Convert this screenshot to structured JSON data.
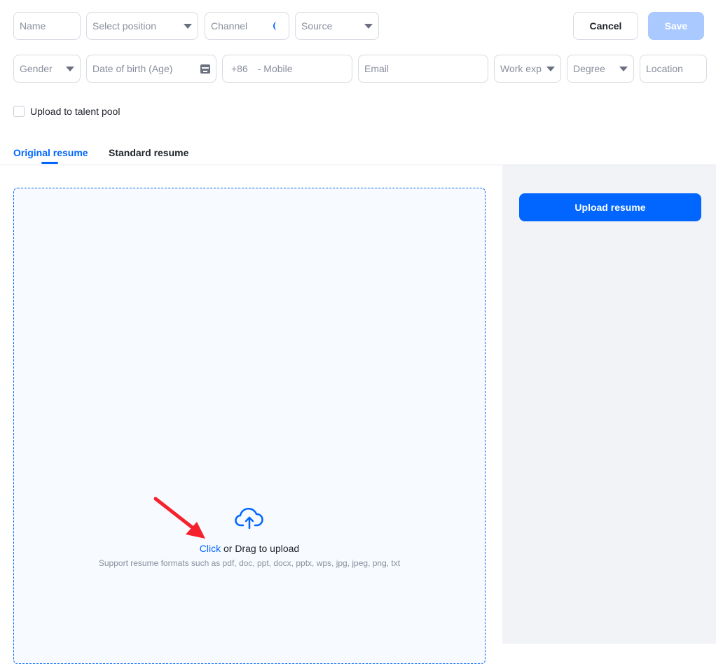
{
  "form": {
    "name_placeholder": "Name",
    "position_placeholder": "Select position",
    "channel_placeholder": "Channel",
    "source_placeholder": "Source",
    "gender_placeholder": "Gender",
    "dob_placeholder": "Date of birth (Age)",
    "country_code": "+86",
    "mobile_placeholder": "- Mobile",
    "email_placeholder": "Email",
    "work_exp_placeholder": "Work exp",
    "degree_placeholder": "Degree",
    "location_placeholder": "Location",
    "talent_pool_label": "Upload to talent pool"
  },
  "actions": {
    "cancel": "Cancel",
    "save": "Save"
  },
  "tabs": [
    {
      "label": "Original resume",
      "active": true
    },
    {
      "label": "Standard resume",
      "active": false
    }
  ],
  "upload": {
    "click": "Click",
    "drag": " or Drag to upload",
    "formats": "Support resume formats such as pdf, doc, ppt, docx, pptx, wps, jpg, jpeg, png, txt",
    "button": "Upload resume"
  },
  "colors": {
    "accent": "#0066ff",
    "save_disabled": "#a9c9ff"
  }
}
